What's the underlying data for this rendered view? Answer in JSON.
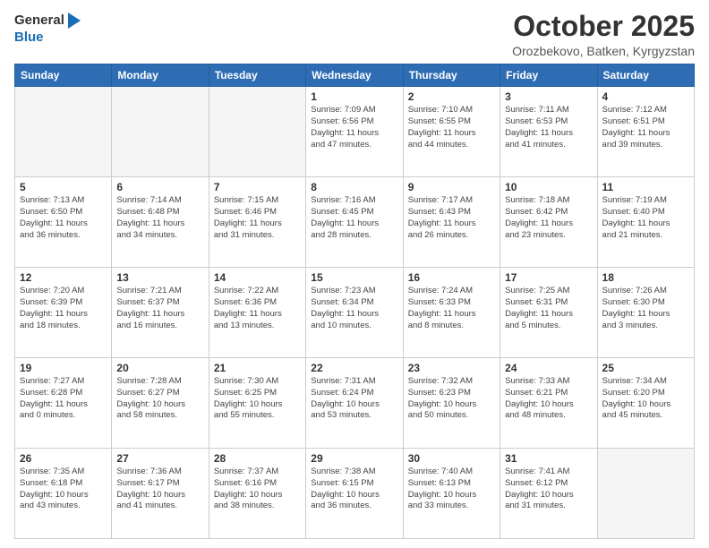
{
  "header": {
    "logo_general": "General",
    "logo_blue": "Blue",
    "month": "October 2025",
    "location": "Orozbekovo, Batken, Kyrgyzstan"
  },
  "days_of_week": [
    "Sunday",
    "Monday",
    "Tuesday",
    "Wednesday",
    "Thursday",
    "Friday",
    "Saturday"
  ],
  "weeks": [
    [
      {
        "day": "",
        "info": ""
      },
      {
        "day": "",
        "info": ""
      },
      {
        "day": "",
        "info": ""
      },
      {
        "day": "1",
        "info": "Sunrise: 7:09 AM\nSunset: 6:56 PM\nDaylight: 11 hours\nand 47 minutes."
      },
      {
        "day": "2",
        "info": "Sunrise: 7:10 AM\nSunset: 6:55 PM\nDaylight: 11 hours\nand 44 minutes."
      },
      {
        "day": "3",
        "info": "Sunrise: 7:11 AM\nSunset: 6:53 PM\nDaylight: 11 hours\nand 41 minutes."
      },
      {
        "day": "4",
        "info": "Sunrise: 7:12 AM\nSunset: 6:51 PM\nDaylight: 11 hours\nand 39 minutes."
      }
    ],
    [
      {
        "day": "5",
        "info": "Sunrise: 7:13 AM\nSunset: 6:50 PM\nDaylight: 11 hours\nand 36 minutes."
      },
      {
        "day": "6",
        "info": "Sunrise: 7:14 AM\nSunset: 6:48 PM\nDaylight: 11 hours\nand 34 minutes."
      },
      {
        "day": "7",
        "info": "Sunrise: 7:15 AM\nSunset: 6:46 PM\nDaylight: 11 hours\nand 31 minutes."
      },
      {
        "day": "8",
        "info": "Sunrise: 7:16 AM\nSunset: 6:45 PM\nDaylight: 11 hours\nand 28 minutes."
      },
      {
        "day": "9",
        "info": "Sunrise: 7:17 AM\nSunset: 6:43 PM\nDaylight: 11 hours\nand 26 minutes."
      },
      {
        "day": "10",
        "info": "Sunrise: 7:18 AM\nSunset: 6:42 PM\nDaylight: 11 hours\nand 23 minutes."
      },
      {
        "day": "11",
        "info": "Sunrise: 7:19 AM\nSunset: 6:40 PM\nDaylight: 11 hours\nand 21 minutes."
      }
    ],
    [
      {
        "day": "12",
        "info": "Sunrise: 7:20 AM\nSunset: 6:39 PM\nDaylight: 11 hours\nand 18 minutes."
      },
      {
        "day": "13",
        "info": "Sunrise: 7:21 AM\nSunset: 6:37 PM\nDaylight: 11 hours\nand 16 minutes."
      },
      {
        "day": "14",
        "info": "Sunrise: 7:22 AM\nSunset: 6:36 PM\nDaylight: 11 hours\nand 13 minutes."
      },
      {
        "day": "15",
        "info": "Sunrise: 7:23 AM\nSunset: 6:34 PM\nDaylight: 11 hours\nand 10 minutes."
      },
      {
        "day": "16",
        "info": "Sunrise: 7:24 AM\nSunset: 6:33 PM\nDaylight: 11 hours\nand 8 minutes."
      },
      {
        "day": "17",
        "info": "Sunrise: 7:25 AM\nSunset: 6:31 PM\nDaylight: 11 hours\nand 5 minutes."
      },
      {
        "day": "18",
        "info": "Sunrise: 7:26 AM\nSunset: 6:30 PM\nDaylight: 11 hours\nand 3 minutes."
      }
    ],
    [
      {
        "day": "19",
        "info": "Sunrise: 7:27 AM\nSunset: 6:28 PM\nDaylight: 11 hours\nand 0 minutes."
      },
      {
        "day": "20",
        "info": "Sunrise: 7:28 AM\nSunset: 6:27 PM\nDaylight: 10 hours\nand 58 minutes."
      },
      {
        "day": "21",
        "info": "Sunrise: 7:30 AM\nSunset: 6:25 PM\nDaylight: 10 hours\nand 55 minutes."
      },
      {
        "day": "22",
        "info": "Sunrise: 7:31 AM\nSunset: 6:24 PM\nDaylight: 10 hours\nand 53 minutes."
      },
      {
        "day": "23",
        "info": "Sunrise: 7:32 AM\nSunset: 6:23 PM\nDaylight: 10 hours\nand 50 minutes."
      },
      {
        "day": "24",
        "info": "Sunrise: 7:33 AM\nSunset: 6:21 PM\nDaylight: 10 hours\nand 48 minutes."
      },
      {
        "day": "25",
        "info": "Sunrise: 7:34 AM\nSunset: 6:20 PM\nDaylight: 10 hours\nand 45 minutes."
      }
    ],
    [
      {
        "day": "26",
        "info": "Sunrise: 7:35 AM\nSunset: 6:18 PM\nDaylight: 10 hours\nand 43 minutes."
      },
      {
        "day": "27",
        "info": "Sunrise: 7:36 AM\nSunset: 6:17 PM\nDaylight: 10 hours\nand 41 minutes."
      },
      {
        "day": "28",
        "info": "Sunrise: 7:37 AM\nSunset: 6:16 PM\nDaylight: 10 hours\nand 38 minutes."
      },
      {
        "day": "29",
        "info": "Sunrise: 7:38 AM\nSunset: 6:15 PM\nDaylight: 10 hours\nand 36 minutes."
      },
      {
        "day": "30",
        "info": "Sunrise: 7:40 AM\nSunset: 6:13 PM\nDaylight: 10 hours\nand 33 minutes."
      },
      {
        "day": "31",
        "info": "Sunrise: 7:41 AM\nSunset: 6:12 PM\nDaylight: 10 hours\nand 31 minutes."
      },
      {
        "day": "",
        "info": ""
      }
    ]
  ]
}
